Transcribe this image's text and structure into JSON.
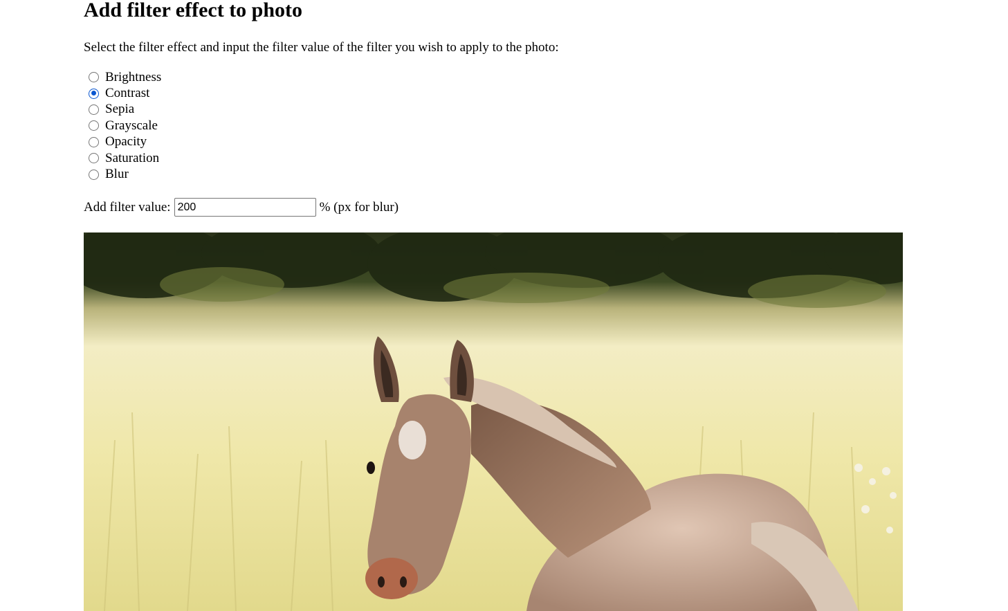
{
  "page": {
    "title": "Add filter effect to photo",
    "intro": "Select the filter effect and input the filter value of the filter you wish to apply to the photo:"
  },
  "filters": {
    "options": [
      {
        "label": "Brightness",
        "checked": false
      },
      {
        "label": "Contrast",
        "checked": true
      },
      {
        "label": "Sepia",
        "checked": false
      },
      {
        "label": "Grayscale",
        "checked": false
      },
      {
        "label": "Opacity",
        "checked": false
      },
      {
        "label": "Saturation",
        "checked": false
      },
      {
        "label": "Blur",
        "checked": false
      }
    ],
    "value_label": "Add filter value:",
    "value": "200",
    "unit_label": "% (px for blur)"
  },
  "photo": {
    "subject": "foal in grassy field",
    "colors": {
      "trees": "#2f3a1c",
      "grass": "#f0e9b4",
      "foal": "#b9917a",
      "accent": "#0b57d0"
    }
  }
}
